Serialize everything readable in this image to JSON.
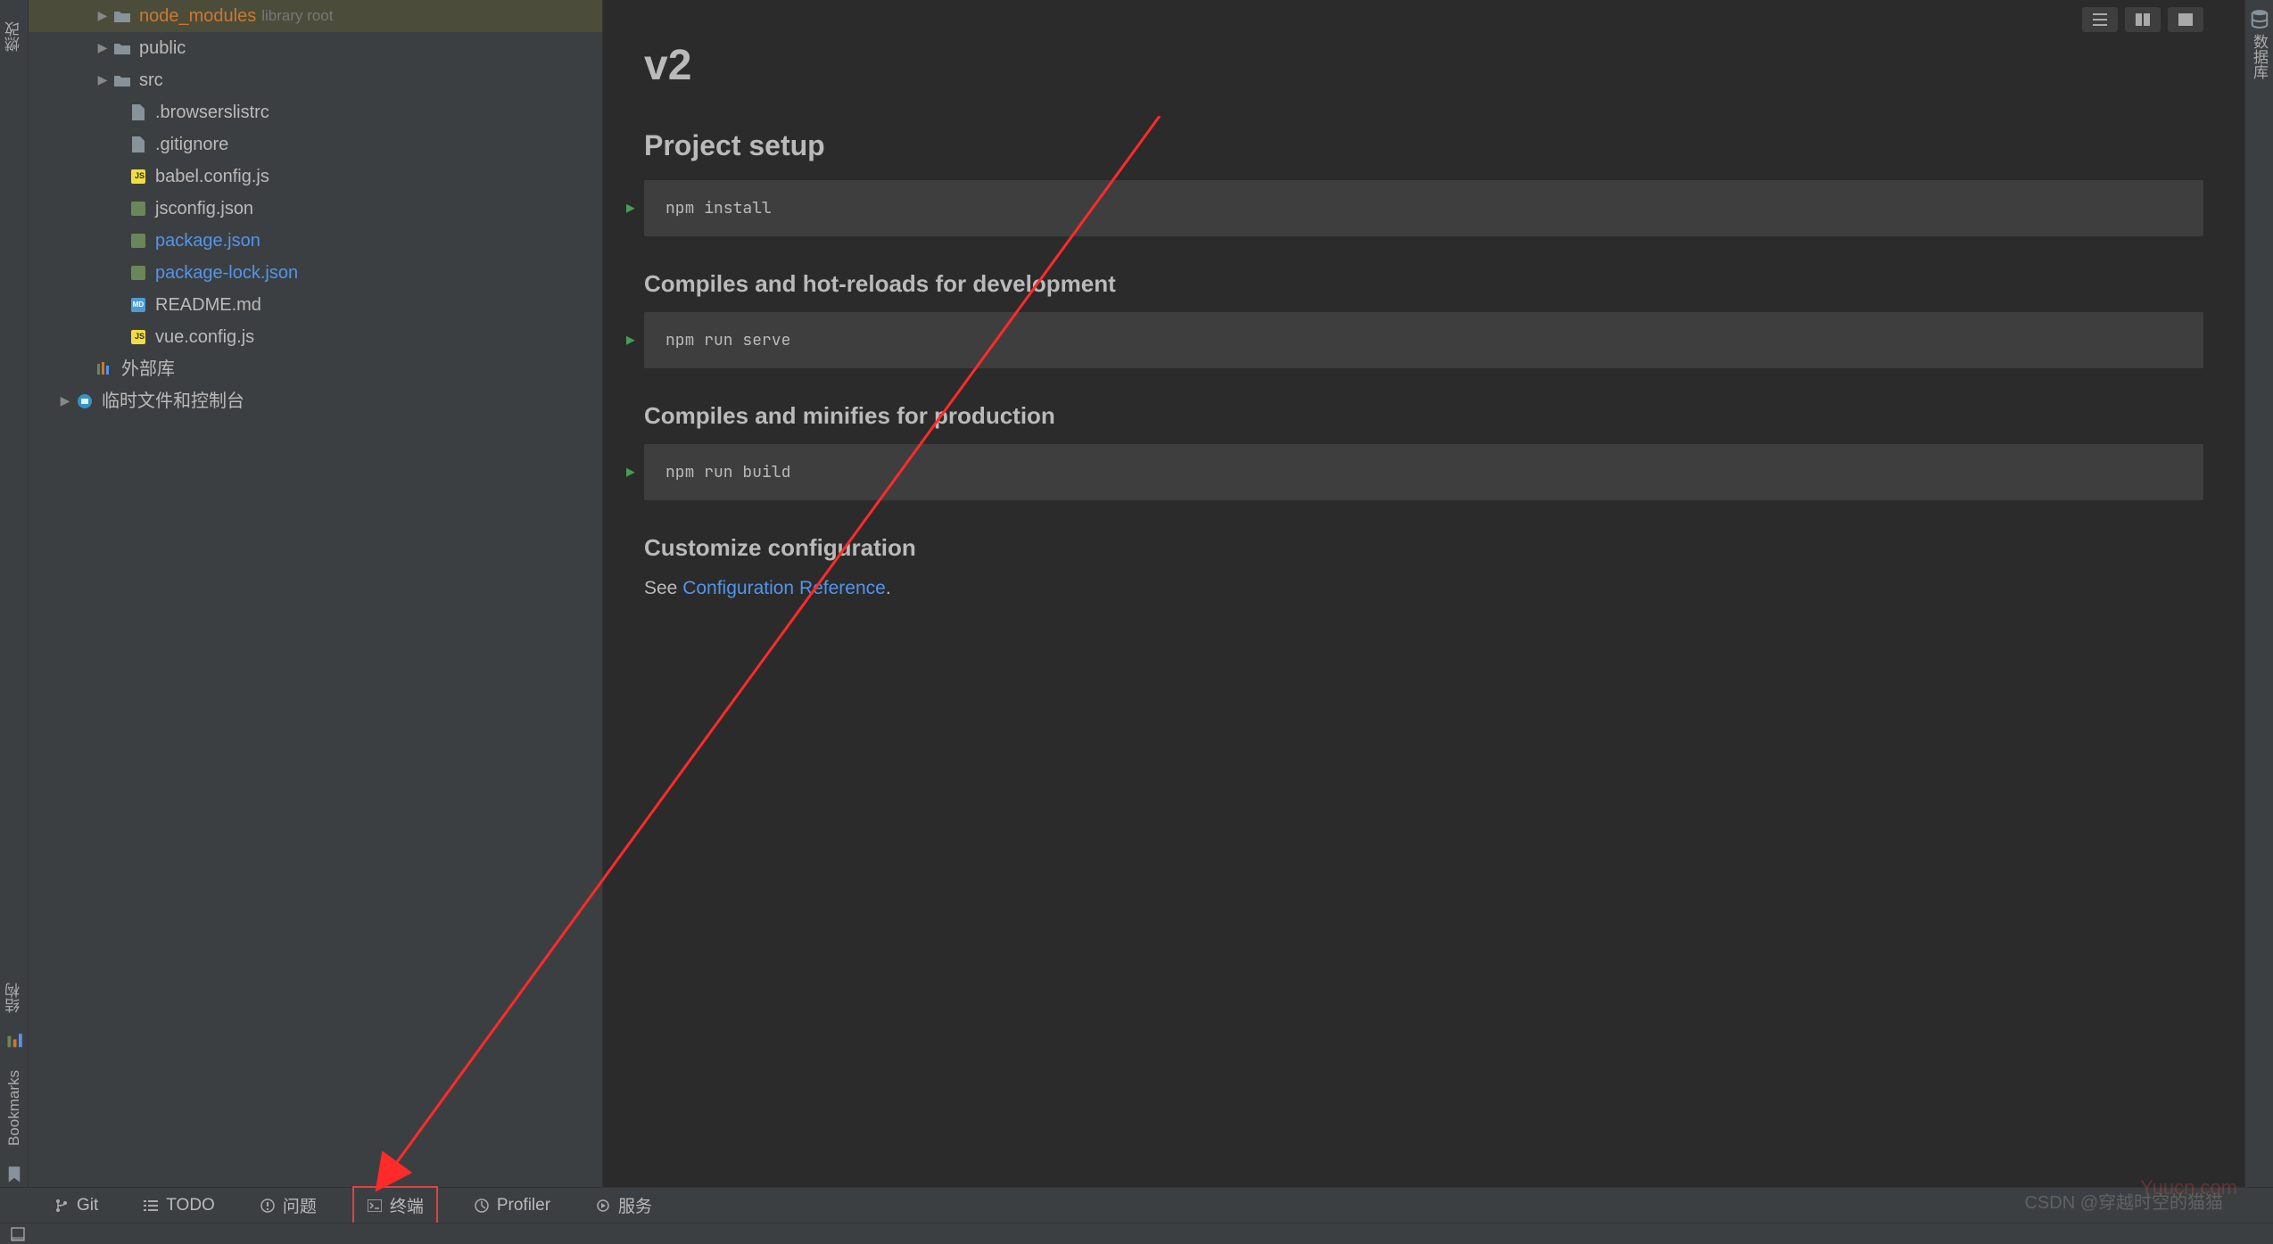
{
  "left_rail": {
    "ranqi": "燃改",
    "struct": "结构",
    "bookmarks": "Bookmarks"
  },
  "right_rail": {
    "db": "数据库"
  },
  "tree": {
    "node_modules": {
      "name": "node_modules",
      "note": "library root"
    },
    "public": "public",
    "src": "src",
    "browserslist": ".browserslistrc",
    "gitignore": ".gitignore",
    "babel": "babel.config.js",
    "jsconfig": "jsconfig.json",
    "pkg": "package.json",
    "pkglock": "package-lock.json",
    "readme": "README.md",
    "vuecfg": "vue.config.js",
    "extlib": "外部库",
    "scratch": "临时文件和控制台"
  },
  "editor": {
    "title": "v2",
    "h2_setup": "Project setup",
    "code_install": "npm install",
    "h3_dev": "Compiles and hot-reloads for development",
    "code_serve": "npm run serve",
    "h3_prod": "Compiles and minifies for production",
    "code_build": "npm run build",
    "h3_custom": "Customize configuration",
    "see_text": "See ",
    "link_text": "Configuration Reference",
    "period": "."
  },
  "bottom": {
    "git": "Git",
    "todo": "TODO",
    "problems": "问题",
    "terminal": "终端",
    "profiler": "Profiler",
    "services": "服务"
  },
  "watermark": {
    "right": "Yuucn.com",
    "csdn": "CSDN @穿越时空的猫猫"
  }
}
